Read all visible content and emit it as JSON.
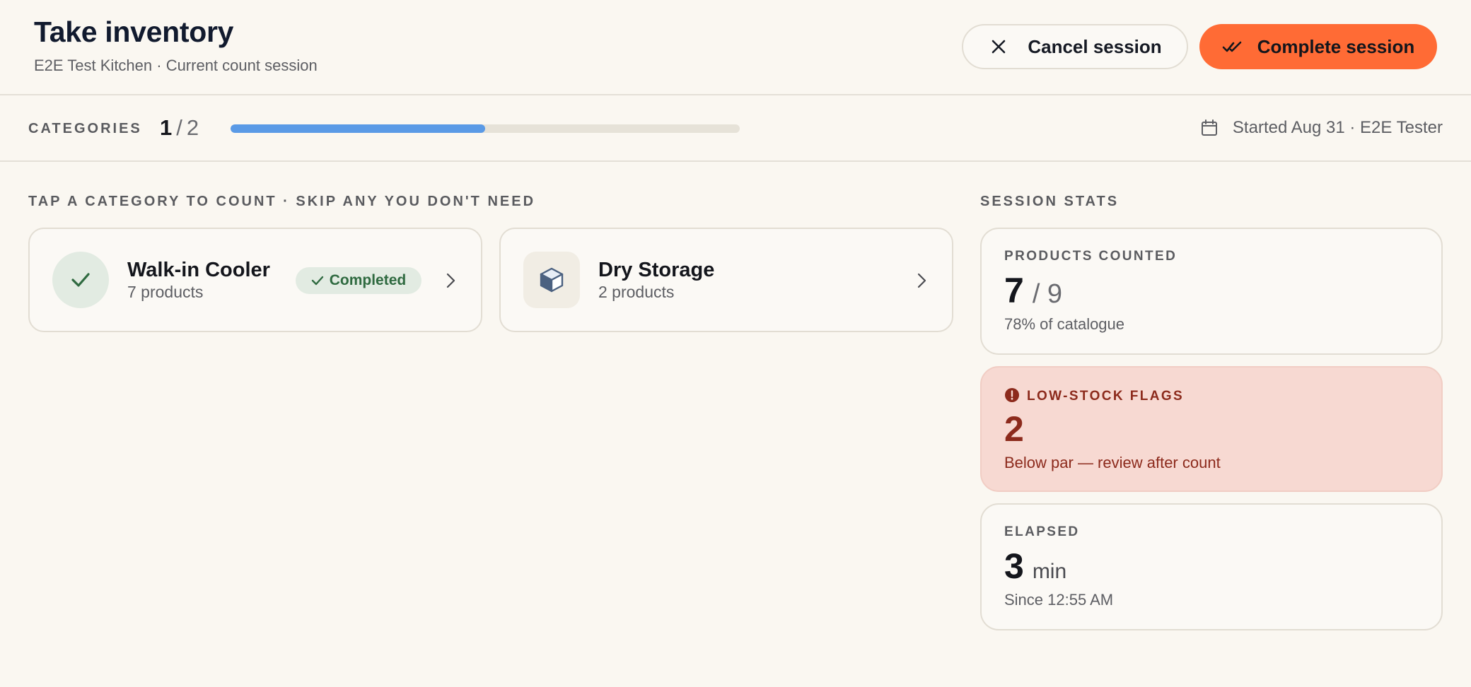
{
  "header": {
    "title": "Take inventory",
    "subtitle": "E2E Test Kitchen · Current count session",
    "cancel_label": "Cancel session",
    "complete_label": "Complete session"
  },
  "progress": {
    "label": "CATEGORIES",
    "current": "1",
    "separator": "/",
    "total": "2",
    "fraction": 0.5,
    "started": "Started Aug 31 · E2E Tester"
  },
  "categories": {
    "heading": "TAP A CATEGORY TO COUNT · SKIP ANY YOU DON'T NEED",
    "items": [
      {
        "name": "Walk-in Cooler",
        "count": "7 products",
        "status": "Completed",
        "icon": "check-icon"
      },
      {
        "name": "Dry Storage",
        "count": "2 products",
        "status": "",
        "icon": "box-icon"
      }
    ]
  },
  "stats": {
    "heading": "SESSION STATS",
    "products": {
      "label": "PRODUCTS COUNTED",
      "value": "7",
      "of": "/ 9",
      "note": "78% of catalogue"
    },
    "low_stock": {
      "label": "LOW-STOCK FLAGS",
      "value": "2",
      "note": "Below par — review after count"
    },
    "elapsed": {
      "label": "ELAPSED",
      "value": "3",
      "unit": "min",
      "note": "Since 12:55 AM"
    }
  },
  "colors": {
    "accent": "#ff6b35",
    "progress": "#5a9ae6",
    "success": "#2f6a40",
    "alert": "#8c2a1c",
    "alert_bg": "#f7d9d2"
  }
}
